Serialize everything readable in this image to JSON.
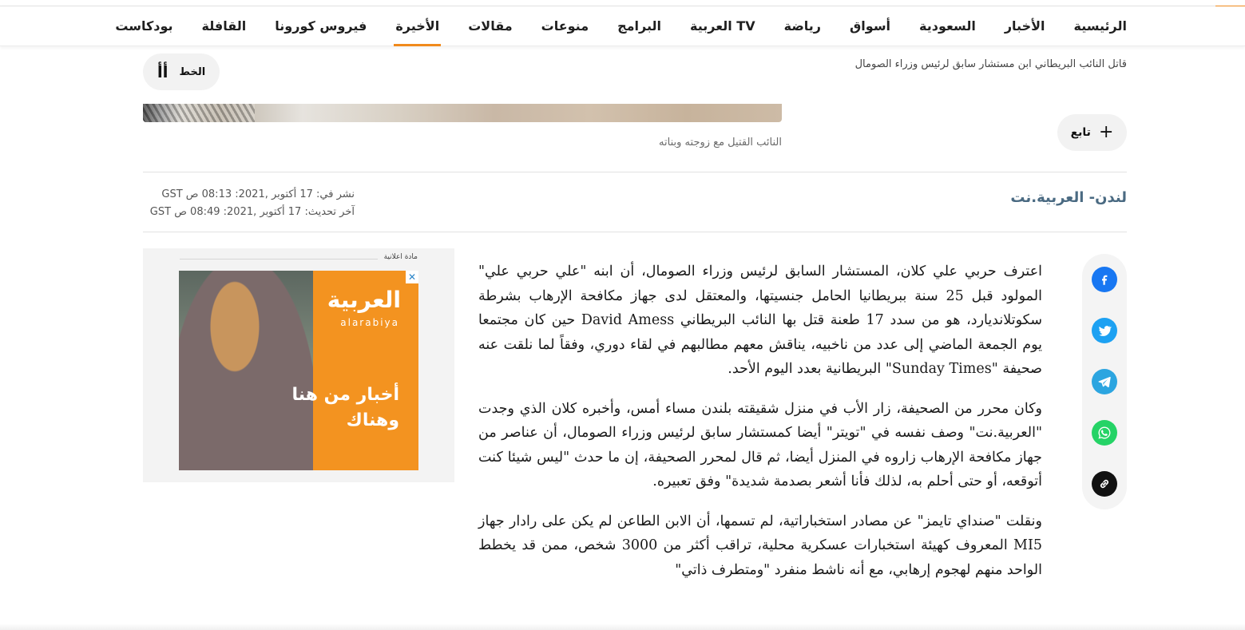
{
  "nav": {
    "items": [
      {
        "label": "الرئيسية",
        "active": false
      },
      {
        "label": "الأخبار",
        "active": false
      },
      {
        "label": "السعودية",
        "active": false
      },
      {
        "label": "أسواق",
        "active": false
      },
      {
        "label": "رياضة",
        "active": false
      },
      {
        "label": "العربية TV",
        "active": false
      },
      {
        "label": "البرامج",
        "active": false
      },
      {
        "label": "منوعات",
        "active": false
      },
      {
        "label": "مقالات",
        "active": false
      },
      {
        "label": "الأخيرة",
        "active": true
      },
      {
        "label": "فيروس كورونا",
        "active": false
      },
      {
        "label": "القافلة",
        "active": false
      },
      {
        "label": "بودكاست",
        "active": false
      }
    ]
  },
  "breadcrumb": "قاتل النائب البريطاني ابن مستشار سابق لرئيس وزراء الصومال",
  "font_control": {
    "glyph": "أأ",
    "label": "الخط"
  },
  "caption": "النائب القتيل مع زوجته وبناته",
  "follow": {
    "label": "تابع",
    "icon": "+"
  },
  "source": "لندن- العربية.نت",
  "dates": {
    "published": "نشر في: 17 أكتوبر ,2021: 08:13 ص GST",
    "updated": "آخر تحديث: 17 أكتوبر ,2021: 08:49 ص GST"
  },
  "ad": {
    "label": "مادة اعلانية",
    "close": "✕",
    "logo": "العربية",
    "logo_sub": "alarabiya",
    "tagline": "أخبار من هنا وهناك"
  },
  "article": {
    "paragraphs": [
      "اعترف حربي علي كلان، المستشار السابق لرئيس وزراء الصومال، أن ابنه \"علي حربي علي\" المولود قبل 25 سنة ببريطانيا الحامل جنسيتها، والمعتقل لدى جهاز مكافحة الإرهاب بشرطة سكوتلانديارد، هو من سدد 17 طعنة قتل بها النائب البريطاني David Amess حين كان مجتمعا يوم الجمعة الماضي إلى عدد من ناخبيه، يناقش معهم مطالبهم في لقاء دوري، وفقاً لما نلقت عنه صحيفة \"Sunday Times\" البريطانية بعدد اليوم الأحد.",
      "وكان محرر من الصحيفة، زار الأب في منزل شقيقته بلندن مساء أمس، وأخبره كلان الذي وجدت \"العربية.نت\" وصف نفسه في \"تويتر\" أيضا كمستشار سابق لرئيس وزراء الصومال، أن عناصر من جهاز مكافحة الإرهاب زاروه في المنزل أيضا، ثم قال لمحرر الصحيفة، إن ما حدث \"ليس شيئا كنت أتوقعه، أو حتى أحلم به، لذلك فأنا أشعر بصدمة شديدة\" وفق تعبيره.",
      "ونقلت \"صنداي تايمز\" عن مصادر استخباراتية، لم تسمها، أن الابن الطاعن لم يكن على رادار جهاز MI5 المعروف كهيئة استخبارات عسكرية محلية، تراقب أكثر من 3000 شخص، ممن قد يخطط الواحد منهم لهجوم إرهابي، مع أنه ناشط منفرد \"ومتطرف ذاتي\""
    ]
  },
  "share": {
    "icons": [
      "facebook-icon",
      "twitter-icon",
      "telegram-icon",
      "whatsapp-icon",
      "link-icon"
    ]
  },
  "colors": {
    "accent": "#f08a1c",
    "source": "#4a6a82"
  }
}
